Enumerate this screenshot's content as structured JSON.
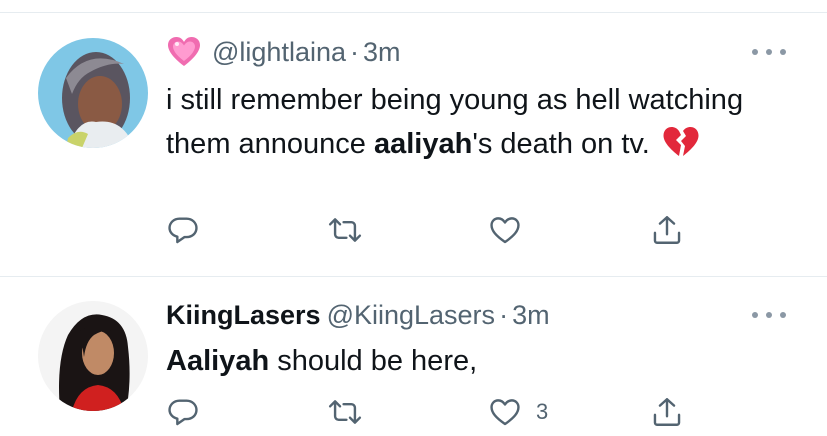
{
  "tweets": [
    {
      "display_name": "",
      "name_emoji_icon": "pink-heart-emoji",
      "handle": "@lightlaina",
      "separator": "·",
      "time": "3m",
      "text_before": "i still remember being young as hell watching them announce ",
      "text_bold": "aaliyah",
      "text_after": "'s death on tv.",
      "trailing_emoji_icon": "broken-heart-emoji",
      "like_count": ""
    },
    {
      "display_name": "KiingLasers",
      "handle": "@KiingLasers",
      "separator": "·",
      "time": "3m",
      "text_before": "",
      "text_bold": "Aaliyah",
      "text_after": " should be here,",
      "like_count": "3"
    }
  ],
  "icons": [
    "reply-icon",
    "retweet-icon",
    "like-icon",
    "share-icon",
    "more-icon"
  ],
  "colors": {
    "text": "#0f1419",
    "secondary": "#536471",
    "divider": "#e6ecf0"
  }
}
